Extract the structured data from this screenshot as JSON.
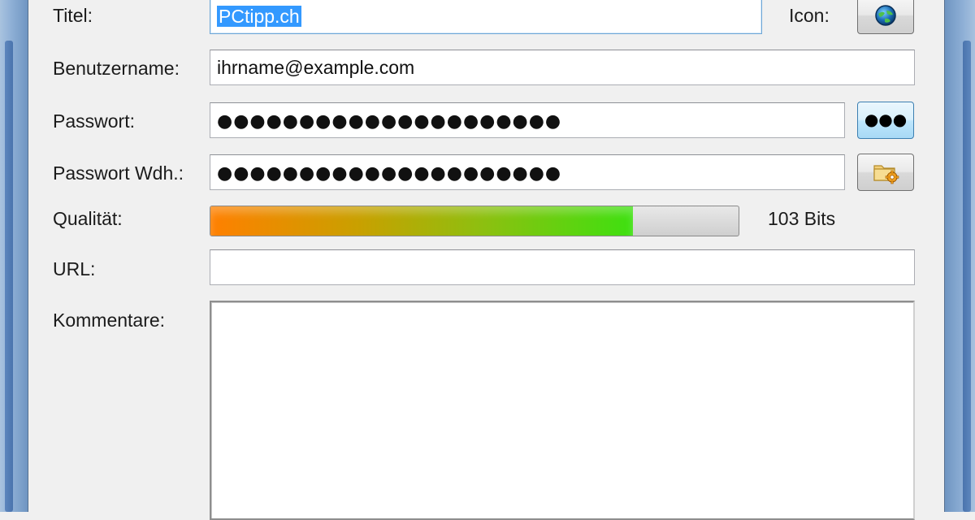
{
  "form": {
    "title_label": "Titel:",
    "title_value": "PCtipp.ch",
    "icon_label": "Icon:",
    "username_label": "Benutzername:",
    "username_value": "ihrname@example.com",
    "password_label": "Passwort:",
    "password_value": "●●●●●●●●●●●●●●●●●●●●●",
    "password_repeat_label": "Passwort Wdh.:",
    "password_repeat_value": "●●●●●●●●●●●●●●●●●●●●●",
    "show_password_button": "●●●",
    "quality_label": "Qualität:",
    "quality_bits": "103 Bits",
    "quality_fraction": 0.8,
    "url_label": "URL:",
    "url_value": "",
    "comments_label": "Kommentare:"
  },
  "icons": {
    "title_icon": "globe-icon",
    "generator_icon": "folder-gear-icon"
  },
  "colors": {
    "selection": "#3399ff",
    "quality_start": "#ff8000",
    "quality_end": "#3ee010"
  }
}
